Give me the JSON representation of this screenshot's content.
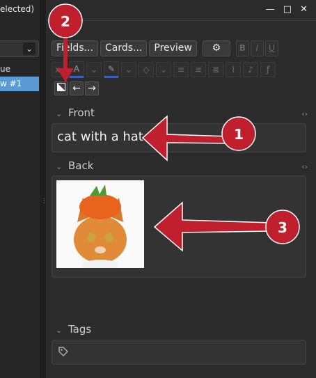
{
  "sidebar": {
    "title_fragment": "elected)",
    "rows": [
      "ue",
      "w #1"
    ]
  },
  "window": {
    "minimize": "—",
    "maximize": "□",
    "close": "✕"
  },
  "toolbar": {
    "fields_label": "Fields...",
    "cards_label": "Cards...",
    "preview_label": "Preview",
    "gear_label": "⚙",
    "bold": "B",
    "italic": "I",
    "underline": "U"
  },
  "fields": [
    {
      "label": "Front",
      "value": "cat with a hat"
    },
    {
      "label": "Back",
      "value": ""
    }
  ],
  "tags": {
    "label": "Tags"
  },
  "annotations": [
    {
      "number": "1"
    },
    {
      "number": "2"
    },
    {
      "number": "3"
    }
  ],
  "colors": {
    "accent": "#c0202d",
    "selection": "#5a9bd3"
  }
}
